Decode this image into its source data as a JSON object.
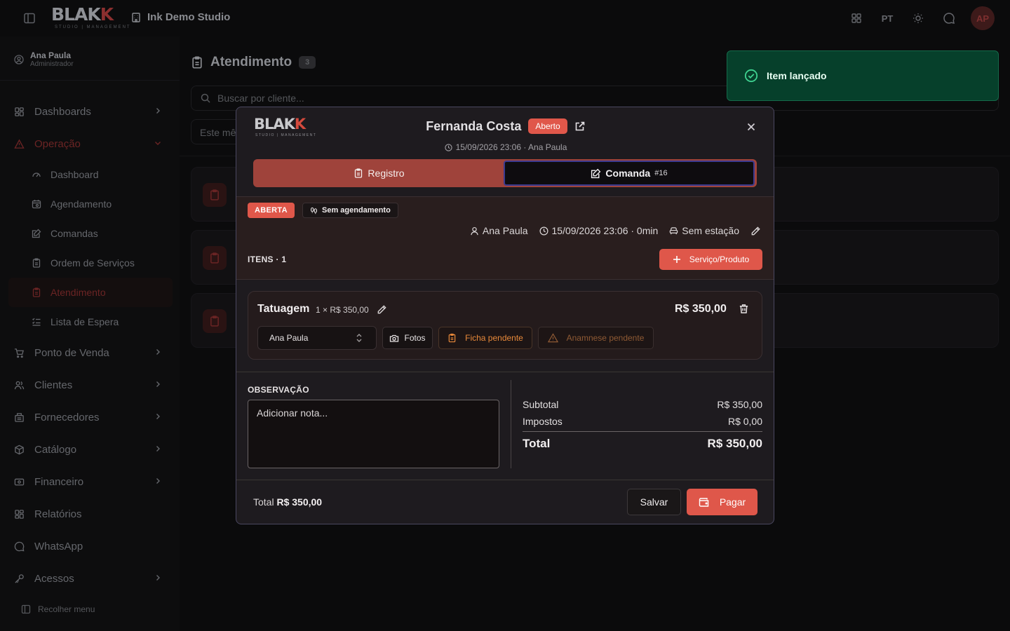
{
  "app": {
    "logo_text": "BLAK",
    "logo_accent": "K",
    "logo_tagline": "STUDIO | MANAGEMENT",
    "studio_name": "Ink Demo Studio",
    "language": "PT",
    "avatar_initials": "AP",
    "accent_color": "#df574a"
  },
  "user": {
    "name": "Ana Paula",
    "role": "Administrador"
  },
  "sidebar": {
    "items": [
      {
        "label": "Dashboards",
        "icon": "grid-icon",
        "expandable": true
      },
      {
        "label": "Operação",
        "icon": "alert-triangle-icon",
        "expandable": true,
        "open": true
      },
      {
        "label": "Ponto de Venda",
        "icon": "cart-icon",
        "expandable": true
      },
      {
        "label": "Clientes",
        "icon": "users-icon",
        "expandable": true
      },
      {
        "label": "Fornecedores",
        "icon": "building-icon",
        "expandable": true
      },
      {
        "label": "Catálogo",
        "icon": "box-icon",
        "expandable": true
      },
      {
        "label": "Financeiro",
        "icon": "wallet-icon",
        "expandable": true
      },
      {
        "label": "Relatórios",
        "icon": "grid-icon",
        "expandable": false
      },
      {
        "label": "WhatsApp",
        "icon": "chat-icon",
        "expandable": false
      },
      {
        "label": "Acessos",
        "icon": "key-icon",
        "expandable": true
      }
    ],
    "sub_items": [
      {
        "label": "Dashboard",
        "icon": "gauge-icon"
      },
      {
        "label": "Agendamento",
        "icon": "calendar-icon"
      },
      {
        "label": "Comandas",
        "icon": "edit-note-icon"
      },
      {
        "label": "Ordem de Serviços",
        "icon": "clipboard-icon"
      },
      {
        "label": "Atendimento",
        "icon": "clipboard-icon",
        "active": true
      },
      {
        "label": "Lista de Espera",
        "icon": "list-icon"
      }
    ],
    "collapse_label": "Recolher menu"
  },
  "main": {
    "title": "Atendimento",
    "count": "3",
    "search_placeholder": "Buscar por cliente...",
    "filter_value": "Este mê"
  },
  "toast": {
    "message": "Item lançado",
    "color": "#06402b"
  },
  "modal": {
    "client_name": "Fernanda Costa",
    "status": "Aberto",
    "datetime_by": "15/09/2026 23:06 · Ana Paula",
    "tabs": {
      "registro": "Registro",
      "comanda": "Comanda",
      "comanda_number": "#16"
    },
    "badge_state": "ABERTA",
    "badge_schedule": "Sem agendamento",
    "meta": {
      "professional": "Ana Paula",
      "datetime": "15/09/2026 23:06 · 0min",
      "station": "Sem estação"
    },
    "items_label": "ITENS · 1",
    "add_button": "Serviço/Produto",
    "item": {
      "name": "Tatuagem",
      "qty_price": "1 × R$ 350,00",
      "total": "R$ 350,00",
      "artist": "Ana Paula",
      "photos": "Fotos",
      "ficha": "Ficha pendente",
      "anamnese": "Anamnese pendente"
    },
    "observation_label": "OBSERVAÇÃO",
    "observation_placeholder": "Adicionar nota...",
    "totals": {
      "subtotal_label": "Subtotal",
      "subtotal": "R$ 350,00",
      "taxes_label": "Impostos",
      "taxes": "R$ 0,00",
      "total_label": "Total",
      "total": "R$ 350,00"
    },
    "footer": {
      "total_label": "Total",
      "total_value": "R$ 350,00",
      "save": "Salvar",
      "pay": "Pagar"
    }
  }
}
